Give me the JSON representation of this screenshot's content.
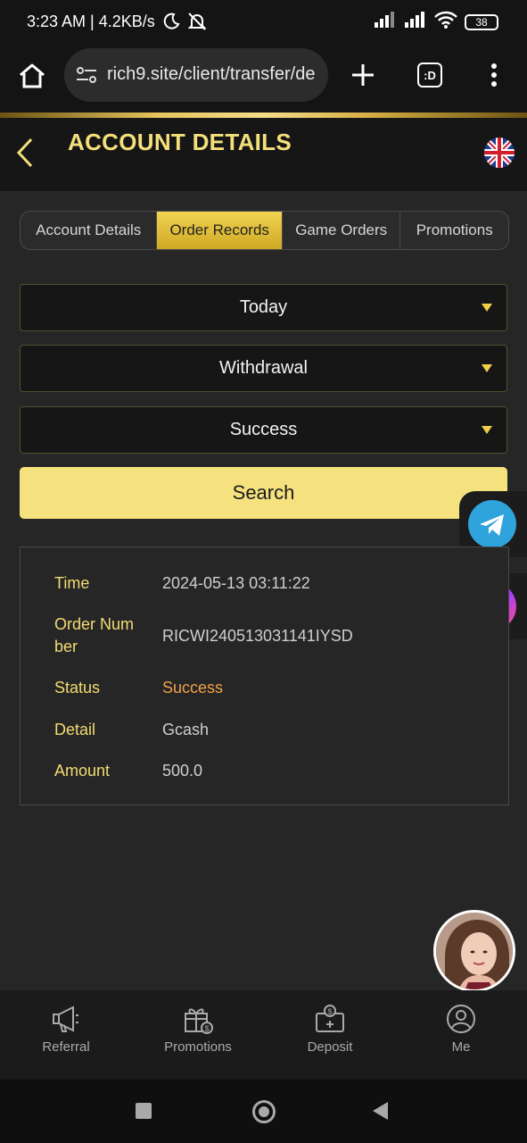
{
  "status_bar": {
    "time_speed": "3:23 AM | 4.2KB/s",
    "battery": "38"
  },
  "browser": {
    "url": "rich9.site/client/transfer/de",
    "tabs_icon_label": ":D"
  },
  "header": {
    "title": "ACCOUNT DETAILS"
  },
  "tabs": [
    {
      "label": "Account Details",
      "active": false
    },
    {
      "label": "Order Records",
      "active": true
    },
    {
      "label": "Game Orders",
      "active": false
    },
    {
      "label": "Promotions",
      "active": false
    }
  ],
  "filters": {
    "date": "Today",
    "type": "Withdrawal",
    "status": "Success"
  },
  "search_label": "Search",
  "record": {
    "time_label": "Time",
    "time_value": "2024-05-13 03:11:22",
    "order_label_1": "Order Num",
    "order_label_2": "ber",
    "order_value": "RICWI240513031141IYSD",
    "status_label": "Status",
    "status_value": "Success",
    "detail_label": "Detail",
    "detail_value": "Gcash",
    "amount_label": "Amount",
    "amount_value": "500.0"
  },
  "bottom_nav": [
    {
      "label": "Referral",
      "icon": "megaphone-icon"
    },
    {
      "label": "Promotions",
      "icon": "gift-icon"
    },
    {
      "label": "Deposit",
      "icon": "wallet-icon"
    },
    {
      "label": "Me",
      "icon": "user-icon"
    }
  ],
  "colors": {
    "accent": "#f4e07a",
    "status_success": "#f3a14a",
    "tab_active": "#e3c33a"
  }
}
